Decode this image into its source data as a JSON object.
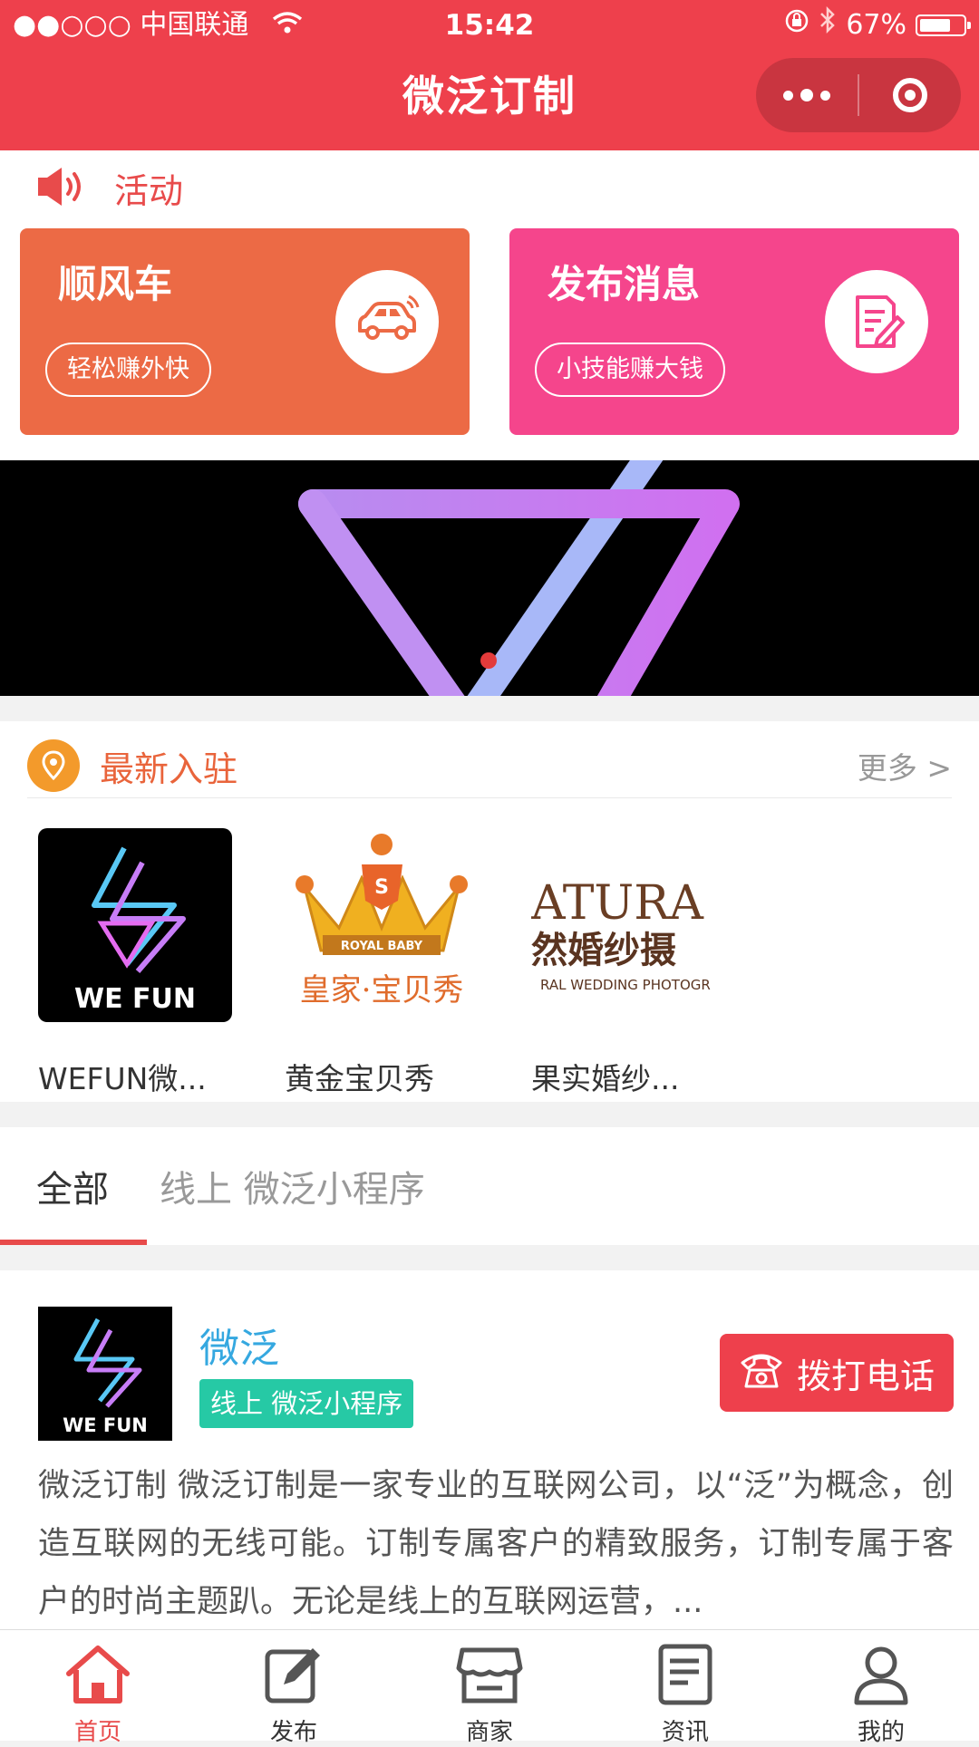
{
  "status_bar": {
    "carrier": "●●○○○ 中国联通",
    "time": "15:42",
    "battery": "67%",
    "battery_level": 0.67
  },
  "header": {
    "title": "微泛订制"
  },
  "activity": {
    "label": "活动",
    "cards": [
      {
        "title": "顺风车",
        "pill": "轻松赚外快",
        "icon": "car-icon",
        "color": "#ec6a45"
      },
      {
        "title": "发布消息",
        "pill": "小技能赚大钱",
        "icon": "edit-document-icon",
        "color": "#f5458c"
      }
    ]
  },
  "newest": {
    "title": "最新入驻",
    "more": "更多 >",
    "items": [
      {
        "name": "WEFUN微...",
        "logo_text": "WE FUN"
      },
      {
        "name": "黄金宝贝秀",
        "logo_text": "ROYAL BABY",
        "logo_subtext": "皇家·宝贝秀"
      },
      {
        "name": "果实婚纱...",
        "logo_text": "ATURA",
        "logo_subtext": "然婚纱摄",
        "logo_caption": "RAL WEDDING PHOTOGR"
      }
    ]
  },
  "tabs": {
    "all": "全部",
    "online": "线上 微泛小程序"
  },
  "listing": {
    "name": "微泛",
    "logo_text": "WE FUN",
    "tag": "线上 微泛小程序",
    "call": "拨打电话",
    "description": "微泛订制 微泛订制是一家专业的互联网公司，以“泛”为概念，创造互联网的无线可能。订制专属客户的精致服务，订制专属于客户的时尚主题趴。无论是线上的互联网运营，..."
  },
  "tabbar": [
    {
      "label": "首页",
      "icon": "home-icon",
      "active": true
    },
    {
      "label": "发布",
      "icon": "edit-icon",
      "active": false
    },
    {
      "label": "商家",
      "icon": "store-icon",
      "active": false
    },
    {
      "label": "资讯",
      "icon": "news-icon",
      "active": false
    },
    {
      "label": "我的",
      "icon": "user-icon",
      "active": false
    }
  ],
  "colors": {
    "primary": "#ee404c",
    "orange": "#ec6a45",
    "pink": "#f5458c",
    "teal": "#26c9a5",
    "blue": "#35a8e0"
  }
}
